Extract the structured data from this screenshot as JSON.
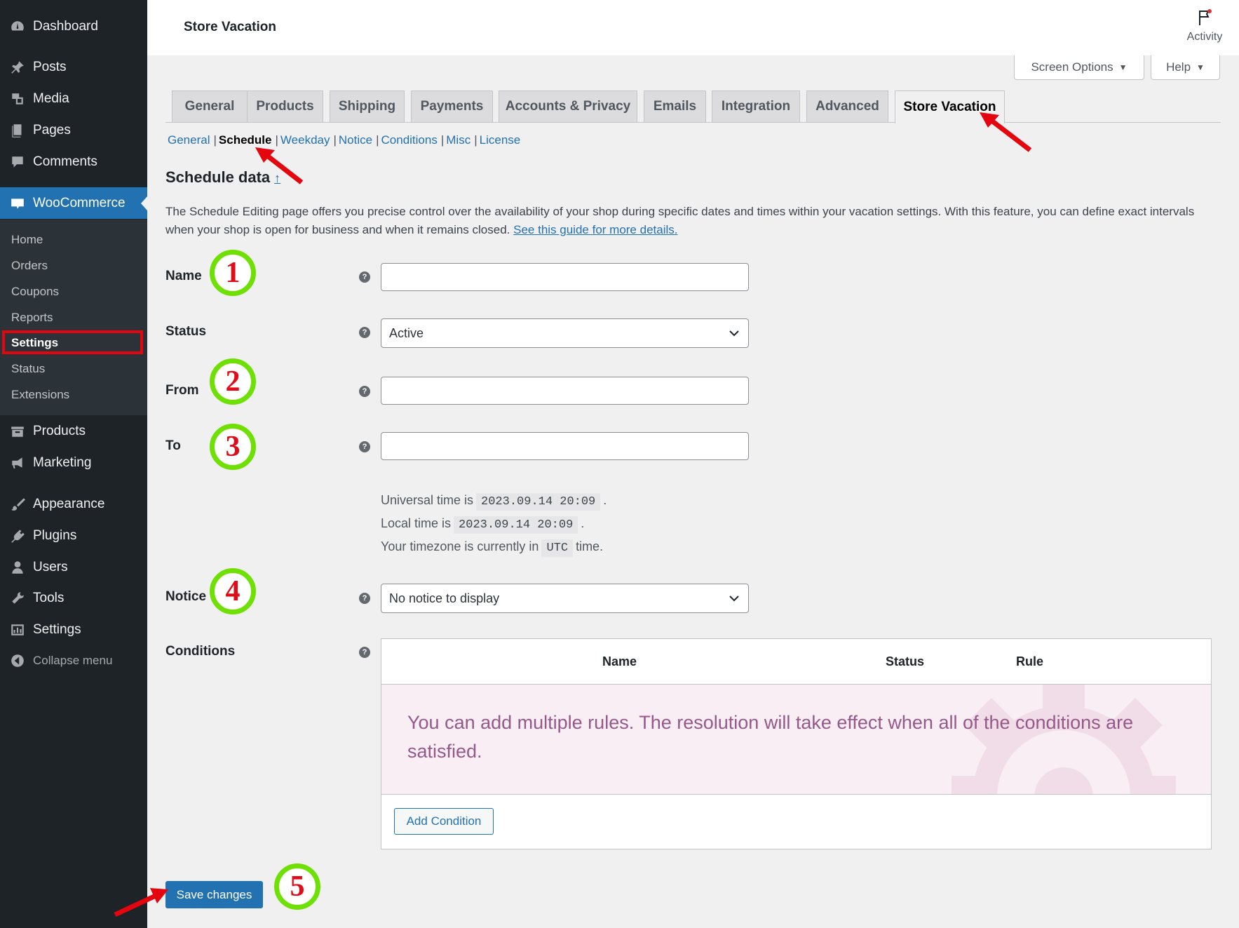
{
  "sidebar": {
    "top_items": [
      {
        "label": "Dashboard",
        "icon": "dashboard-icon"
      },
      {
        "label": "Posts",
        "icon": "pin-icon"
      },
      {
        "label": "Media",
        "icon": "media-icon"
      },
      {
        "label": "Pages",
        "icon": "pages-icon"
      },
      {
        "label": "Comments",
        "icon": "comment-icon"
      },
      {
        "label": "WooCommerce",
        "icon": "woo-icon"
      }
    ],
    "woo_submenu": [
      "Home",
      "Orders",
      "Coupons",
      "Reports",
      "Settings",
      "Status",
      "Extensions"
    ],
    "bottom_items": [
      {
        "label": "Products",
        "icon": "archive-icon"
      },
      {
        "label": "Marketing",
        "icon": "megaphone-icon"
      },
      {
        "label": "Appearance",
        "icon": "brush-icon"
      },
      {
        "label": "Plugins",
        "icon": "plugin-icon"
      },
      {
        "label": "Users",
        "icon": "user-icon"
      },
      {
        "label": "Tools",
        "icon": "wrench-icon"
      },
      {
        "label": "Settings",
        "icon": "settings-icon"
      },
      {
        "label": "Collapse menu",
        "icon": "collapse-icon"
      }
    ]
  },
  "header": {
    "title": "Store Vacation",
    "activity_label": "Activity"
  },
  "screen_meta": {
    "screen_options": "Screen Options",
    "help": "Help"
  },
  "tabs": [
    "General",
    "Products",
    "Shipping",
    "Payments",
    "Accounts & Privacy",
    "Emails",
    "Integration",
    "Advanced",
    "Store Vacation"
  ],
  "active_tab": "Store Vacation",
  "subnav": [
    "General",
    "Schedule",
    "Weekday",
    "Notice",
    "Conditions",
    "Misc",
    "License"
  ],
  "active_subnav": "Schedule",
  "section": {
    "title": "Schedule data",
    "up_link": "↑",
    "description": "The Schedule Editing page offers you precise control over the availability of your shop during specific dates and times within your vacation settings. With this feature, you can define exact intervals when your shop is open for business and when it remains closed.",
    "guide_link": "See this guide for more details."
  },
  "fields": {
    "name": {
      "label": "Name",
      "value": ""
    },
    "status": {
      "label": "Status",
      "value": "Active"
    },
    "from": {
      "label": "From",
      "value": ""
    },
    "to": {
      "label": "To",
      "value": ""
    },
    "notice": {
      "label": "Notice",
      "value": "No notice to display"
    },
    "conditions": {
      "label": "Conditions"
    }
  },
  "time_info": {
    "universal_prefix": "Universal time is",
    "universal_value": "2023.09.14 20:09",
    "local_prefix": "Local time is",
    "local_value": "2023.09.14 20:09",
    "tz_prefix": "Your timezone is currently in",
    "tz_value": "UTC",
    "tz_suffix": "time.",
    "period": "."
  },
  "conditions_table": {
    "headers": [
      "Name",
      "Status",
      "Rule"
    ],
    "empty_message": "You can add multiple rules. The resolution will take effect when all of the conditions are satisfied.",
    "add_button": "Add Condition"
  },
  "save_button": "Save changes",
  "help_tip_glyph": "?",
  "annotations": [
    "1",
    "2",
    "3",
    "4",
    "5"
  ],
  "colors": {
    "accent": "#2271b1",
    "sidebar_bg": "#1d2327",
    "highlight_red": "#e4050f",
    "badge_green": "#6fe003",
    "woo_purple": "#96588a"
  }
}
